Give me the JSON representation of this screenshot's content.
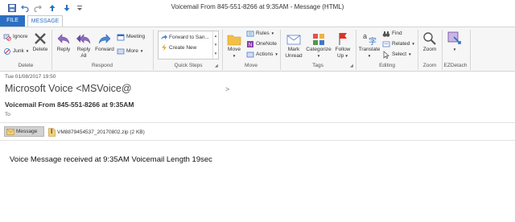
{
  "window": {
    "title": "Voicemail From 845-551-8266 at 9:35AM - Message (HTML)"
  },
  "quick_access": [
    "save-icon",
    "undo-icon",
    "redo-icon",
    "up-arrow-icon",
    "down-arrow-icon",
    "customize-icon"
  ],
  "tabs": [
    {
      "label": "FILE"
    },
    {
      "label": "MESSAGE"
    }
  ],
  "ribbon": {
    "delete_group": {
      "label": "Delete",
      "ignore": "Ignore",
      "junk": "Junk",
      "delete": "Delete"
    },
    "respond_group": {
      "label": "Respond",
      "reply": "Reply",
      "reply_all_1": "Reply",
      "reply_all_2": "All",
      "forward": "Forward",
      "meeting": "Meeting",
      "more": "More"
    },
    "quick_steps": {
      "label": "Quick Steps",
      "items": [
        "Forward to San...",
        "Create New"
      ]
    },
    "move_group": {
      "label": "Move",
      "move": "Move",
      "rules": "Rules",
      "onenote": "OneNote",
      "actions": "Actions"
    },
    "tags_group": {
      "label": "Tags",
      "mark_unread_1": "Mark",
      "mark_unread_2": "Unread",
      "categorize": "Categorize",
      "follow_up_1": "Follow",
      "follow_up_2": "Up"
    },
    "editing_group": {
      "label": "Editing",
      "translate": "Translate",
      "find": "Find",
      "related": "Related",
      "select": "Select"
    },
    "zoom_group": {
      "label": "Zoom",
      "zoom": "Zoom"
    },
    "ezdetach_group": {
      "label": "EZDetach"
    }
  },
  "message": {
    "date": "Tue 01/08/2017 19:50",
    "sender": "Microsoft Voice <MSVoice@",
    "expand_glyph": ">",
    "subject": "Voicemail From 845-551-8266 at 9:35AM",
    "to_label": "To"
  },
  "attachments": {
    "message_label": "Message",
    "file_name": "VM8879454537_20170802.zip (2 KB)"
  },
  "body": {
    "text": "Voice Message received at 9:35AM Voicemail Length 19sec"
  },
  "colors": {
    "accent": "#2b6fc2",
    "ribbon_bg": "#f6f6f6"
  }
}
